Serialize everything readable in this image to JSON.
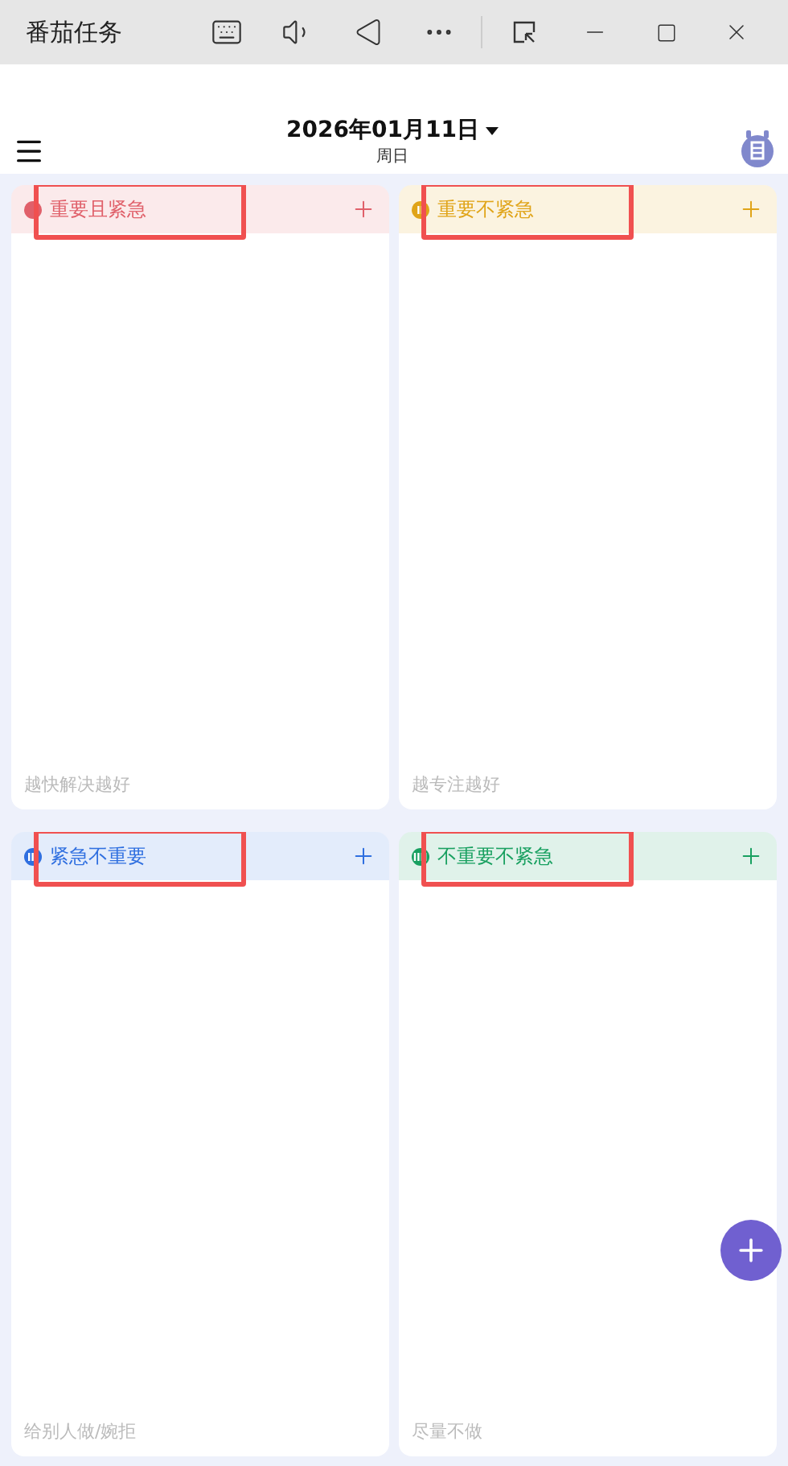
{
  "window": {
    "title": "番茄任务"
  },
  "header": {
    "date": "2026年01月11日",
    "weekday": "周日"
  },
  "quadrants": [
    {
      "title": "重要且紧急",
      "hint": "越快解决越好",
      "color": "#e0606a",
      "kind": "dot",
      "highlighted": true
    },
    {
      "title": "重要不紧急",
      "hint": "越专注越好",
      "color": "#e0a418",
      "kind": "two",
      "highlighted": true
    },
    {
      "title": "紧急不重要",
      "hint": "给别人做/婉拒",
      "color": "#2f6fe0",
      "kind": "three",
      "highlighted": true
    },
    {
      "title": "不重要不紧急",
      "hint": "尽量不做",
      "color": "#18a060",
      "kind": "four",
      "highlighted": true
    }
  ]
}
